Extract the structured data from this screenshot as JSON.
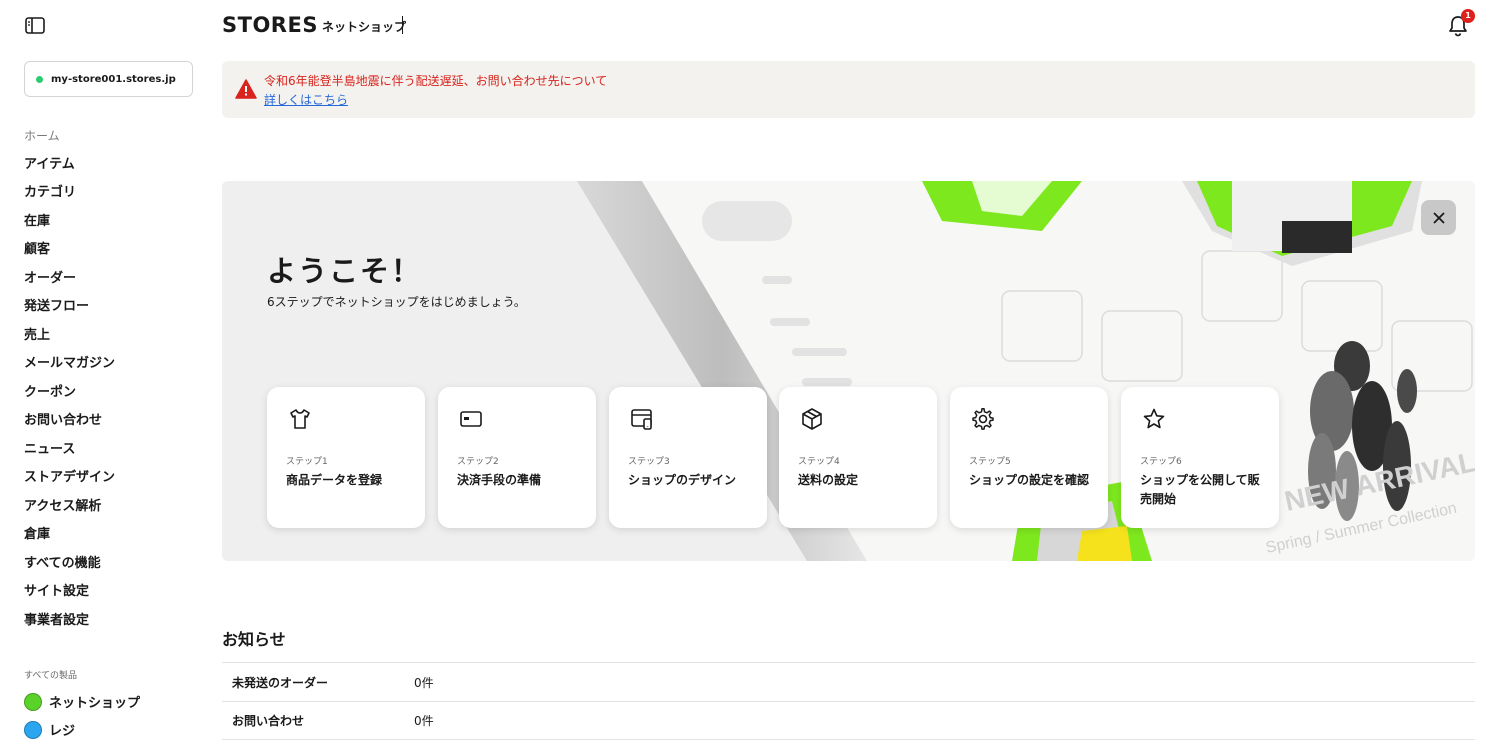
{
  "header": {
    "logo": "STORES",
    "subtitle": "ネットショップ",
    "notification_count": "1"
  },
  "store": {
    "name": "my-store001.stores.jp",
    "status_color": "#2ecc71"
  },
  "sidebar": {
    "items": [
      {
        "label": "ホーム"
      },
      {
        "label": "アイテム"
      },
      {
        "label": "カテゴリ"
      },
      {
        "label": "在庫"
      },
      {
        "label": "顧客"
      },
      {
        "label": "オーダー"
      },
      {
        "label": "発送フロー"
      },
      {
        "label": "売上"
      },
      {
        "label": "メールマガジン"
      },
      {
        "label": "クーポン"
      },
      {
        "label": "お問い合わせ"
      },
      {
        "label": "ニュース"
      },
      {
        "label": "ストアデザイン"
      },
      {
        "label": "アクセス解析"
      },
      {
        "label": "倉庫"
      },
      {
        "label": "すべての機能"
      },
      {
        "label": "サイト設定"
      },
      {
        "label": "事業者設定"
      }
    ],
    "products_label": "すべての製品",
    "products": [
      {
        "label": "ネットショップ",
        "color": "#5ad22a"
      },
      {
        "label": "レジ",
        "color": "#2aa6f0"
      }
    ]
  },
  "alert": {
    "message": "令和6年能登半島地震に伴う配送遅延、お問い合わせ先について",
    "link": "詳しくはこちら",
    "color": "#d9231d"
  },
  "hero": {
    "title": "ようこそ！",
    "subtitle": "6ステップでネットショップをはじめましょう。",
    "steps": [
      {
        "num": "ステップ1",
        "title": "商品データを登録",
        "icon": "tshirt-icon"
      },
      {
        "num": "ステップ2",
        "title": "決済手段の準備",
        "icon": "card-icon"
      },
      {
        "num": "ステップ3",
        "title": "ショップのデザイン",
        "icon": "browser-design-icon"
      },
      {
        "num": "ステップ4",
        "title": "送料の設定",
        "icon": "box-icon"
      },
      {
        "num": "ステップ5",
        "title": "ショップの設定を確認",
        "icon": "gear-icon"
      },
      {
        "num": "ステップ6",
        "title": "ショップを公開して販売開始",
        "icon": "star-icon"
      }
    ],
    "decor_text": {
      "arrival": "NEW ARRIVAL",
      "collection": "Spring / Summer Collection"
    }
  },
  "notices": {
    "title": "お知らせ",
    "rows": [
      {
        "label": "未発送のオーダー",
        "value": "0件"
      },
      {
        "label": "お問い合わせ",
        "value": "0件"
      }
    ]
  },
  "accent_color": "#7ee81e"
}
